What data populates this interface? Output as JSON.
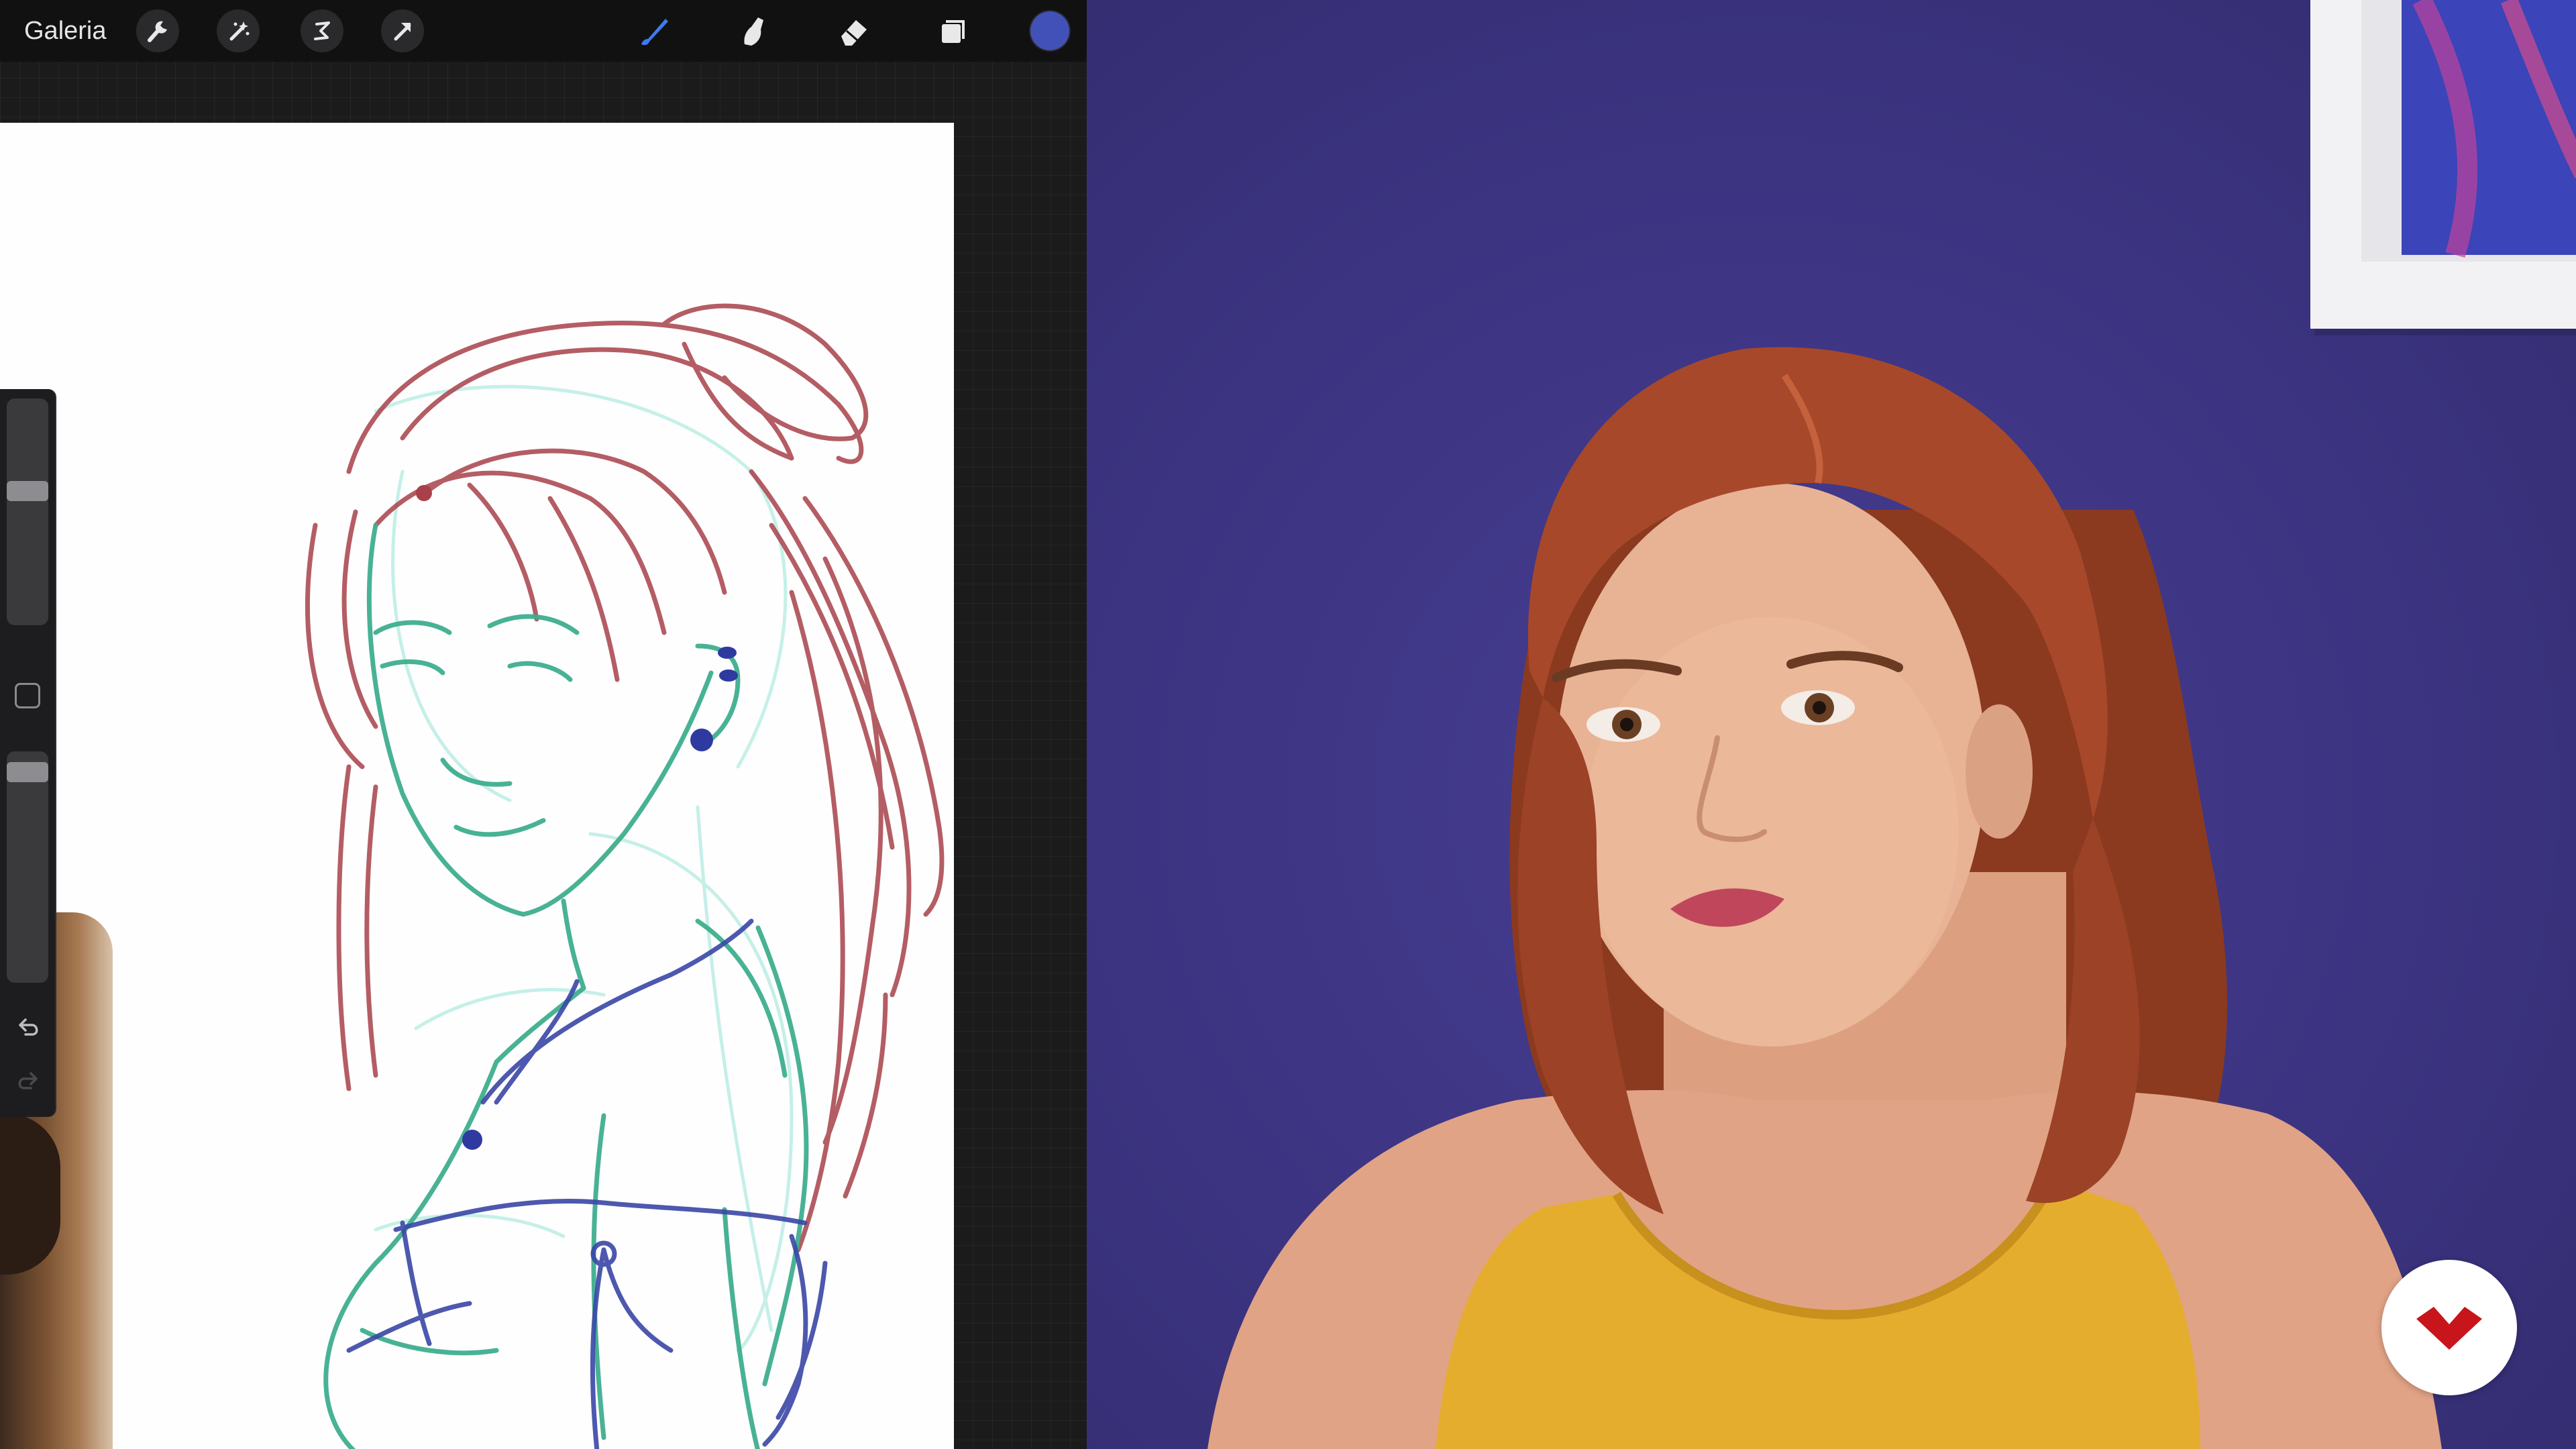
{
  "toolbar": {
    "gallery_label": "Galeria",
    "left_tools": [
      "wrench-icon",
      "magic-wand-icon",
      "selection-icon",
      "transform-arrow-icon"
    ],
    "right_tools": [
      "brush-icon",
      "smudge-icon",
      "eraser-icon",
      "layers-icon"
    ],
    "active_tool": "brush-icon",
    "current_color": "#4151b8"
  },
  "sidebar": {
    "brush_size_level": 0.4,
    "opacity_level": 0.05,
    "buttons": [
      "modify-square",
      "undo-icon",
      "redo-icon"
    ]
  },
  "canvas": {
    "background": "#ffffff",
    "stroke_colors": {
      "hair": "#a8414a",
      "body": "#3fae8f",
      "details": "#3a47a6"
    }
  },
  "video": {
    "background": "#3d3581",
    "logo": "domestika-logo"
  }
}
